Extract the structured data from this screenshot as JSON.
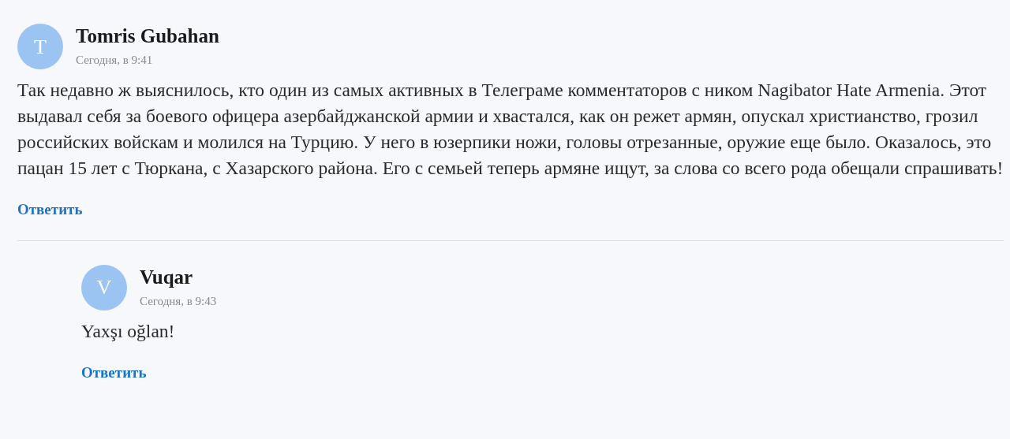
{
  "comments": [
    {
      "avatar_letter": "T",
      "author": "Tomris Gubahan",
      "time": "Сегодня, в 9:41",
      "text": "Так недавно ж выяснилось, кто один из самых активных в Телеграме комментаторов с ником Nagibator Hate Armenia. Этот выдавал себя за боевого офицера азербайджанской армии и хвастался, как он режет армян, опускал христианство, грозил российских войскам и молился на Турцию. У него в юзерпики ножи, головы отрезанные, оружие еще было. Оказалось, это пацан 15 лет с Тюркана, с Хазарского района. Его с семьей теперь армяне ищут, за слова со всего рода обещали спрашивать!",
      "reply_link": "Ответить",
      "children": [
        {
          "avatar_letter": "V",
          "author": "Vuqar",
          "time": "Сегодня, в 9:43",
          "text": "Yaxşı oğlan!",
          "reply_link": "Ответить"
        }
      ]
    }
  ]
}
